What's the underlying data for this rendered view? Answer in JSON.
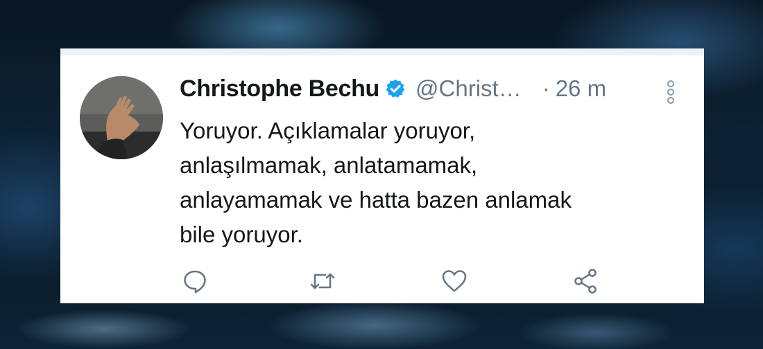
{
  "tweet": {
    "author": {
      "name": "Christophe Bechu",
      "handle": "@Christ…",
      "verified": true
    },
    "separator": "·",
    "time": "26 m",
    "text_lines": [
      "Yoruyor. Açıklamalar yoruyor,",
      "anlaşılmamak, anlatamamak,",
      "anlayamamak ve hatta bazen anlamak",
      "bile yoruyor."
    ],
    "actions": [
      {
        "icon": "reply-icon"
      },
      {
        "icon": "retweet-icon"
      },
      {
        "icon": "like-icon"
      },
      {
        "icon": "share-icon"
      }
    ],
    "menu_icon": "more-vertical-icon"
  },
  "colors": {
    "text": "#14171a",
    "muted": "#657786",
    "verified": "#1da1f2",
    "card_background": "#ffffff"
  }
}
